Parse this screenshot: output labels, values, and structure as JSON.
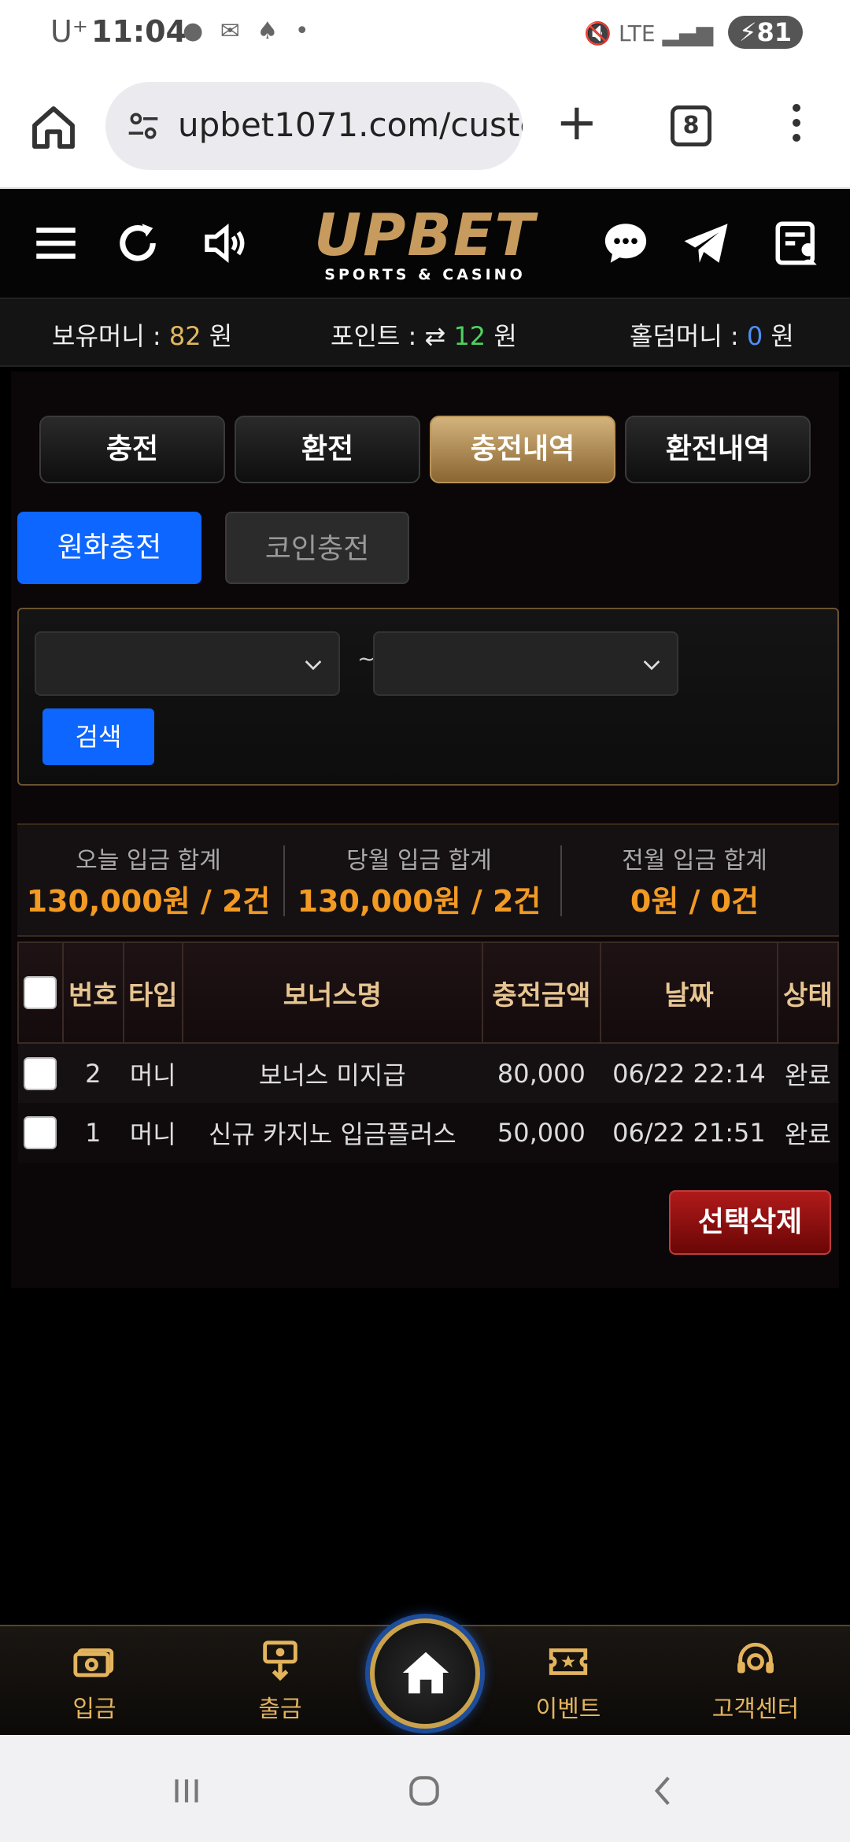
{
  "status_bar": {
    "carrier": "U⁺",
    "time": "11:04",
    "battery": "81",
    "network": "LTE"
  },
  "browser": {
    "url": "upbet1071.com/custo",
    "tab_count": "8"
  },
  "header": {
    "logo_main": "UPBET",
    "logo_sub": "SPORTS & CASINO"
  },
  "balance": {
    "money_label": "보유머니 : ",
    "money_value": "82",
    "money_unit": " 원",
    "point_label": "포인트 : ",
    "point_value": "12",
    "point_unit": " 원",
    "holdem_label": "홀덤머니 : ",
    "holdem_value": "0",
    "holdem_unit": " 원"
  },
  "tabs": [
    {
      "label": "충전",
      "active": false
    },
    {
      "label": "환전",
      "active": false
    },
    {
      "label": "충전내역",
      "active": true
    },
    {
      "label": "환전내역",
      "active": false
    }
  ],
  "subtabs": {
    "won": "원화충전",
    "coin": "코인충전"
  },
  "search": {
    "tilde": "~",
    "button": "검색"
  },
  "summary": [
    {
      "label": "오늘 입금 합계",
      "value": "130,000원 / 2건"
    },
    {
      "label": "당월 입금 합계",
      "value": "130,000원 / 2건"
    },
    {
      "label": "전월 입금 합계",
      "value": "0원 / 0건"
    }
  ],
  "table": {
    "headers": [
      "번호",
      "타입",
      "보너스명",
      "충전금액",
      "날짜",
      "상태"
    ],
    "rows": [
      {
        "no": "2",
        "type": "머니",
        "bonus": "보너스 미지급",
        "amount": "80,000",
        "date": "06/22 22:14",
        "status": "완료"
      },
      {
        "no": "1",
        "type": "머니",
        "bonus": "신규 카지노 입금플러스",
        "amount": "50,000",
        "date": "06/22 21:51",
        "status": "완료"
      }
    ]
  },
  "delete_button": "선택삭제",
  "bottom_nav": {
    "deposit": "입금",
    "withdraw": "출금",
    "event": "이벤트",
    "support": "고객센터"
  },
  "colors": {
    "accent_gold": "#c79b5e",
    "primary_blue": "#0d66ff",
    "amount_orange": "#f19a24",
    "delete_red": "#b01a1a"
  }
}
